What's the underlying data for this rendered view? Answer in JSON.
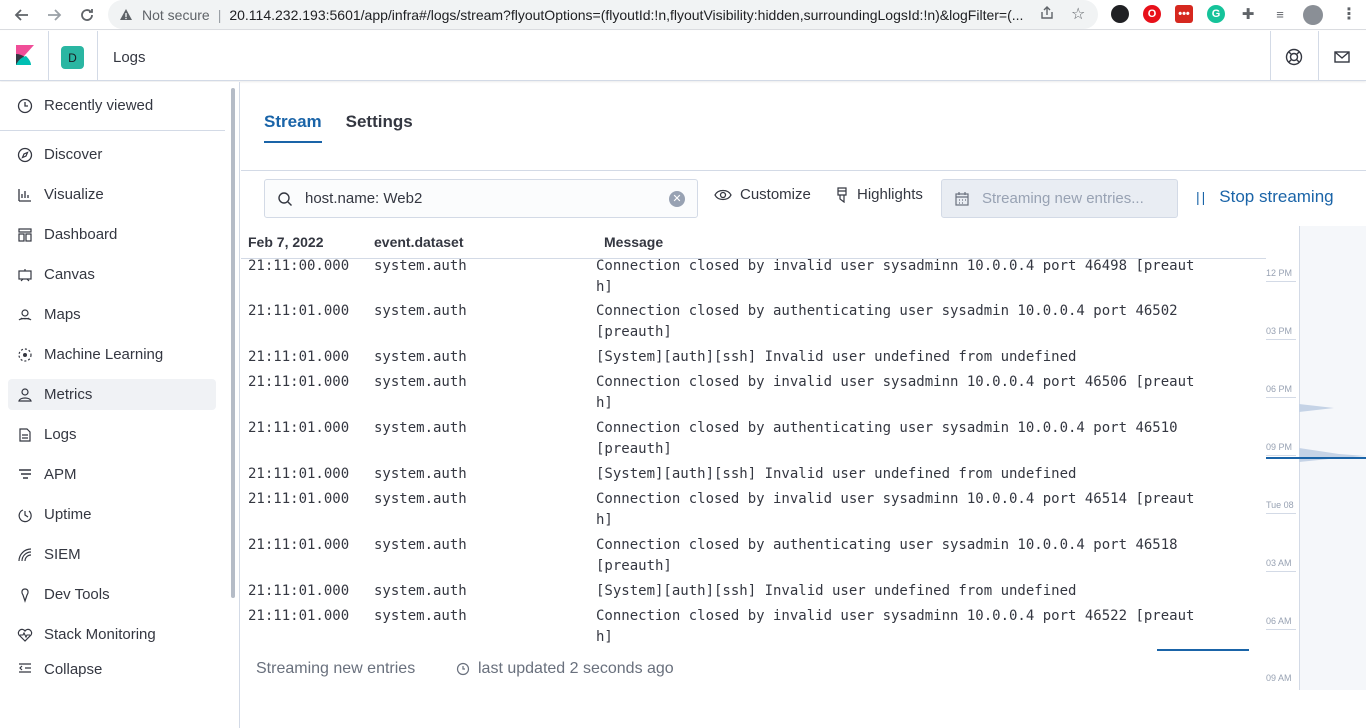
{
  "browser": {
    "not_secure": "Not secure",
    "url": "20.114.232.193:5601/app/infra#/logs/stream?flyoutOptions=(flyoutId:!n,flyoutVisibility:hidden,surroundingLogsId:!n)&logFilter=(..."
  },
  "header": {
    "space_initial": "D",
    "app_title": "Logs"
  },
  "sidebar": {
    "items": [
      {
        "label": "Recently viewed",
        "icon": "clock-icon"
      },
      {
        "label": "Discover",
        "icon": "compass-icon"
      },
      {
        "label": "Visualize",
        "icon": "visualize-icon"
      },
      {
        "label": "Dashboard",
        "icon": "dashboard-icon"
      },
      {
        "label": "Canvas",
        "icon": "canvas-icon"
      },
      {
        "label": "Maps",
        "icon": "maps-icon"
      },
      {
        "label": "Machine Learning",
        "icon": "ml-icon"
      },
      {
        "label": "Metrics",
        "icon": "metrics-icon"
      },
      {
        "label": "Logs",
        "icon": "logs-icon"
      },
      {
        "label": "APM",
        "icon": "apm-icon"
      },
      {
        "label": "Uptime",
        "icon": "uptime-icon"
      },
      {
        "label": "SIEM",
        "icon": "siem-icon"
      },
      {
        "label": "Dev Tools",
        "icon": "devtools-icon"
      },
      {
        "label": "Stack Monitoring",
        "icon": "monitoring-icon"
      }
    ],
    "collapse": "Collapse"
  },
  "tabs": {
    "stream": "Stream",
    "settings": "Settings"
  },
  "toolbar": {
    "search_value": "host.name: Web2",
    "customize": "Customize",
    "highlights": "Highlights",
    "streaming_placeholder": "Streaming new entries...",
    "stop_streaming": "Stop streaming"
  },
  "columns": {
    "date": "Feb 7, 2022",
    "dataset": "event.dataset",
    "message": "Message"
  },
  "rows": [
    {
      "ts": "21:11:00.000",
      "ds": "system.auth",
      "msg": "Connection closed by invalid user sysadminn 10.0.0.4 port 46498 [preauth]"
    },
    {
      "ts": "21:11:01.000",
      "ds": "system.auth",
      "msg": "Connection closed by authenticating user sysadmin 10.0.0.4 port 46502 [preauth]"
    },
    {
      "ts": "21:11:01.000",
      "ds": "system.auth",
      "msg": "[System][auth][ssh] Invalid user undefined from undefined"
    },
    {
      "ts": "21:11:01.000",
      "ds": "system.auth",
      "msg": "Connection closed by invalid user sysadminn 10.0.0.4 port 46506 [preauth]"
    },
    {
      "ts": "21:11:01.000",
      "ds": "system.auth",
      "msg": "Connection closed by authenticating user sysadmin 10.0.0.4 port 46510 [preauth]"
    },
    {
      "ts": "21:11:01.000",
      "ds": "system.auth",
      "msg": "[System][auth][ssh] Invalid user undefined from undefined"
    },
    {
      "ts": "21:11:01.000",
      "ds": "system.auth",
      "msg": "Connection closed by invalid user sysadminn 10.0.0.4 port 46514 [preauth]"
    },
    {
      "ts": "21:11:01.000",
      "ds": "system.auth",
      "msg": "Connection closed by authenticating user sysadmin 10.0.0.4 port 46518 [preauth]"
    },
    {
      "ts": "21:11:01.000",
      "ds": "system.auth",
      "msg": "[System][auth][ssh] Invalid user undefined from undefined"
    },
    {
      "ts": "21:11:01.000",
      "ds": "system.auth",
      "msg": "Connection closed by invalid user sysadminn 10.0.0.4 port 46522 [preauth]"
    }
  ],
  "footer": {
    "status": "Streaming new entries",
    "updated": "last updated 2 seconds ago"
  },
  "minimap": {
    "ticks": [
      "12 PM",
      "03 PM",
      "06 PM",
      "09 PM",
      "Tue 08",
      "03 AM",
      "06 AM",
      "09 AM"
    ]
  },
  "colors": {
    "accent": "#1a64a8",
    "space_badge": "#2ab6a2"
  }
}
